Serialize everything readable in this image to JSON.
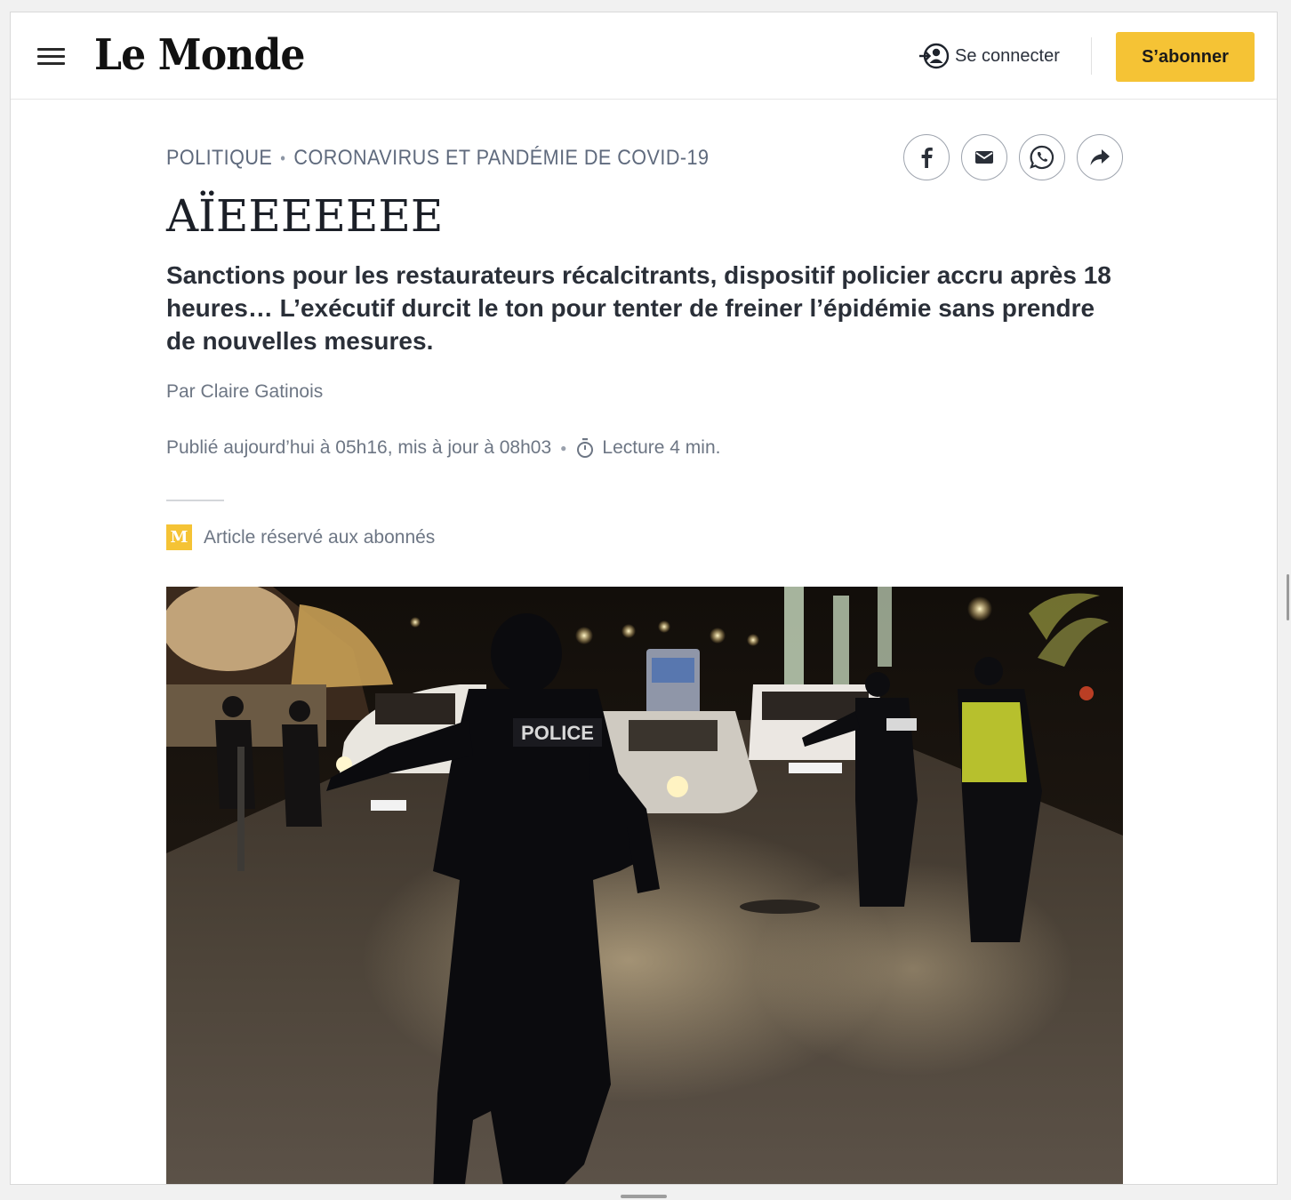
{
  "header": {
    "logo": "Le Monde",
    "login_label": "Se connecter",
    "subscribe_label": "S’abonner"
  },
  "article": {
    "kicker": [
      "POLITIQUE",
      "CORONAVIRUS ET PANDÉMIE DE COVID-19"
    ],
    "title": "AÏEEEEEEE",
    "lead": "Sanctions pour les restaurateurs récalcitrants, dispositif policier accru après 18 heures… L’exécutif durcit le ton pour tenter de freiner l’épidémie sans prendre de nouvelles mesures.",
    "byline_prefix": "Par",
    "author": "Claire Gatinois",
    "published": "Publié aujourd’hui à 05h16, mis à jour à 08h03",
    "reading_time": "Lecture 4 min.",
    "reserved_badge": "M",
    "reserved_label": "Article réservé aux abonnés",
    "photo_police_text": "POLICE"
  },
  "share": {
    "icons": [
      "facebook-icon",
      "email-icon",
      "whatsapp-icon",
      "share-icon"
    ]
  },
  "colors": {
    "accent_yellow": "#f5c335",
    "kicker_grey": "#5f6a7d",
    "text_dark": "#1b1f27"
  }
}
